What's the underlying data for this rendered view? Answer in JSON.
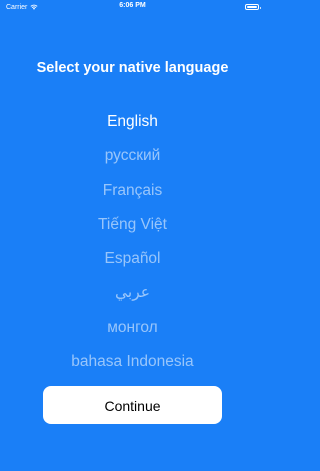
{
  "status_bar": {
    "carrier": "Carrier",
    "time": "6:06 PM"
  },
  "title": "Select your native language",
  "languages": [
    {
      "label": "English",
      "selected": true
    },
    {
      "label": "русский",
      "selected": false
    },
    {
      "label": "Français",
      "selected": false
    },
    {
      "label": "Tiếng Việt",
      "selected": false
    },
    {
      "label": "Español",
      "selected": false
    },
    {
      "label": "عربي",
      "selected": false
    },
    {
      "label": "монгол",
      "selected": false
    },
    {
      "label": "bahasa Indonesia",
      "selected": false
    }
  ],
  "continue_label": "Continue",
  "colors": {
    "background": "#1a7ff7",
    "selected_text": "#ffffff",
    "unselected_text": "rgba(255,255,255,0.55)",
    "button_bg": "#ffffff"
  }
}
